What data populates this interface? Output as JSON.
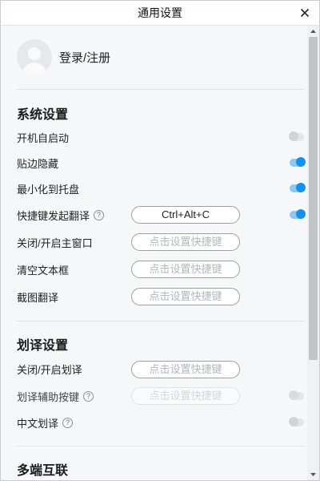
{
  "window": {
    "title": "通用设置"
  },
  "profile": {
    "login_label": "登录/注册"
  },
  "system": {
    "title": "系统设置",
    "autostart": {
      "label": "开机自启动",
      "enabled": false
    },
    "edge_hide": {
      "label": "贴边隐藏",
      "enabled": true
    },
    "minimize_tray": {
      "label": "最小化到托盘",
      "enabled": true
    },
    "hotkey_translate": {
      "label": "快捷键发起翻译",
      "hotkey": "Ctrl+Alt+C",
      "enabled": true
    },
    "toggle_main_window": {
      "label": "关闭/开启主窗口",
      "placeholder": "点击设置快捷键"
    },
    "clear_textbox": {
      "label": "清空文本框",
      "placeholder": "点击设置快捷键"
    },
    "screenshot_translate": {
      "label": "截图翻译",
      "placeholder": "点击设置快捷键"
    }
  },
  "selection": {
    "title": "划译设置",
    "toggle_selection": {
      "label": "关闭/开启划译",
      "placeholder": "点击设置快捷键"
    },
    "assist_button": {
      "label": "划译辅助按键",
      "placeholder": "点击设置快捷键",
      "enabled": false
    },
    "chinese_selection": {
      "label": "中文划译",
      "enabled": false
    }
  },
  "multi_device": {
    "title": "多端互联"
  },
  "icons": {
    "help": "?",
    "close": "close-icon",
    "avatar": "user-avatar-icon"
  },
  "colors": {
    "accent": "#1690e8",
    "toggle_on_track": "#8fc7f3",
    "toggle_off": "#d0d3d7"
  }
}
